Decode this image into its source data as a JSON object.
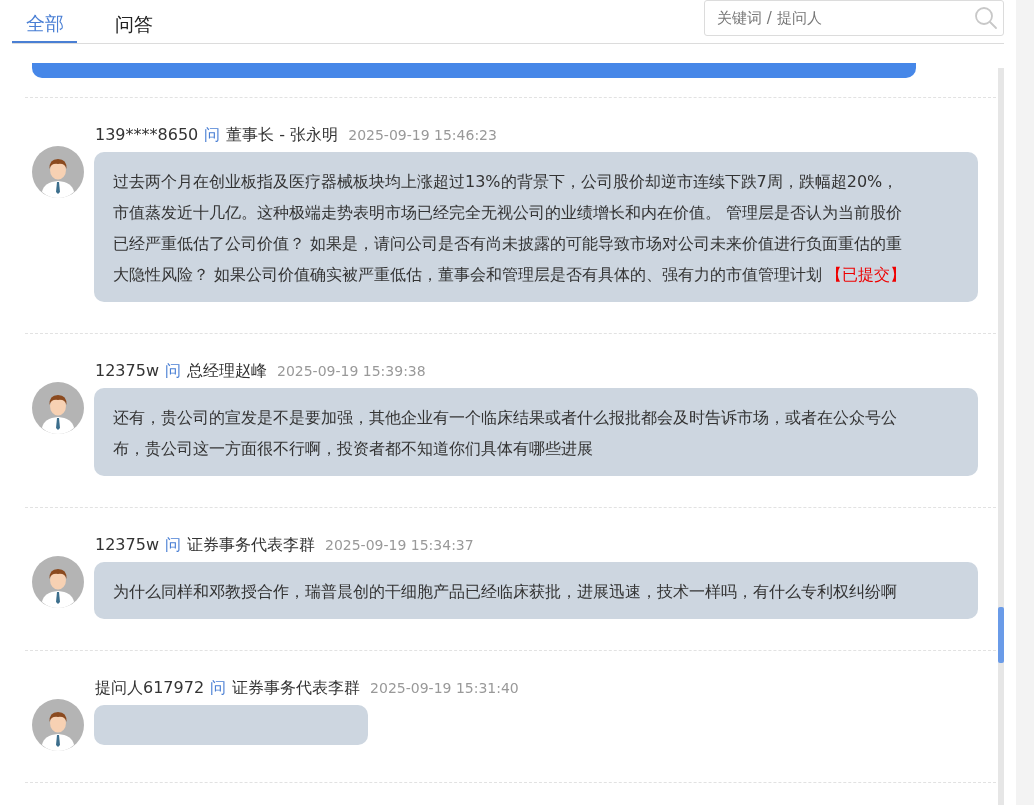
{
  "tabs": [
    {
      "label": "全部",
      "selected": true
    },
    {
      "label": "问答",
      "selected": false
    }
  ],
  "search": {
    "placeholder": "关键词 / 提问人"
  },
  "questions": [
    {
      "asker": "139****8650",
      "marker": "问",
      "responder": "董事长 - 张永明",
      "time": "2025-09-19 15:46:23",
      "text": "过去两个月在创业板指及医疗器械板块均上涨超过13%的背景下，公司股价却逆市连续下跌7周，跌幅超20%，市值蒸发近十几亿。这种极端走势表明市场已经完全无视公司的业绩增长和内在价值。 管理层是否认为当前股价已经严重低估了公司价值？ 如果是，请问公司是否有尚未披露的可能导致市场对公司未来价值进行负面重估的重大隐性风险？ 如果公司价值确实被严重低估，董事会和管理层是否有具体的、强有力的市值管理计划",
      "status": "【已提交】"
    },
    {
      "asker": "12375w",
      "marker": "问",
      "responder": "总经理赵峰",
      "time": "2025-09-19 15:39:38",
      "text": "还有，贵公司的宣发是不是要加强，其他企业有一个临床结果或者什么报批都会及时告诉市场，或者在公众号公布，贵公司这一方面很不行啊，投资者都不知道你们具体有哪些进展"
    },
    {
      "asker": "12375w",
      "marker": "问",
      "responder": "证券事务代表李群",
      "time": "2025-09-19 15:34:37",
      "text": "为什么同样和邓教授合作，瑞普晨创的干细胞产品已经临床获批，进展迅速，技术一样吗，有什么专利权纠纷啊"
    },
    {
      "asker": "提问人617972",
      "marker": "问",
      "responder": "证券事务代表李群",
      "time": "2025-09-19 15:31:40"
    }
  ]
}
